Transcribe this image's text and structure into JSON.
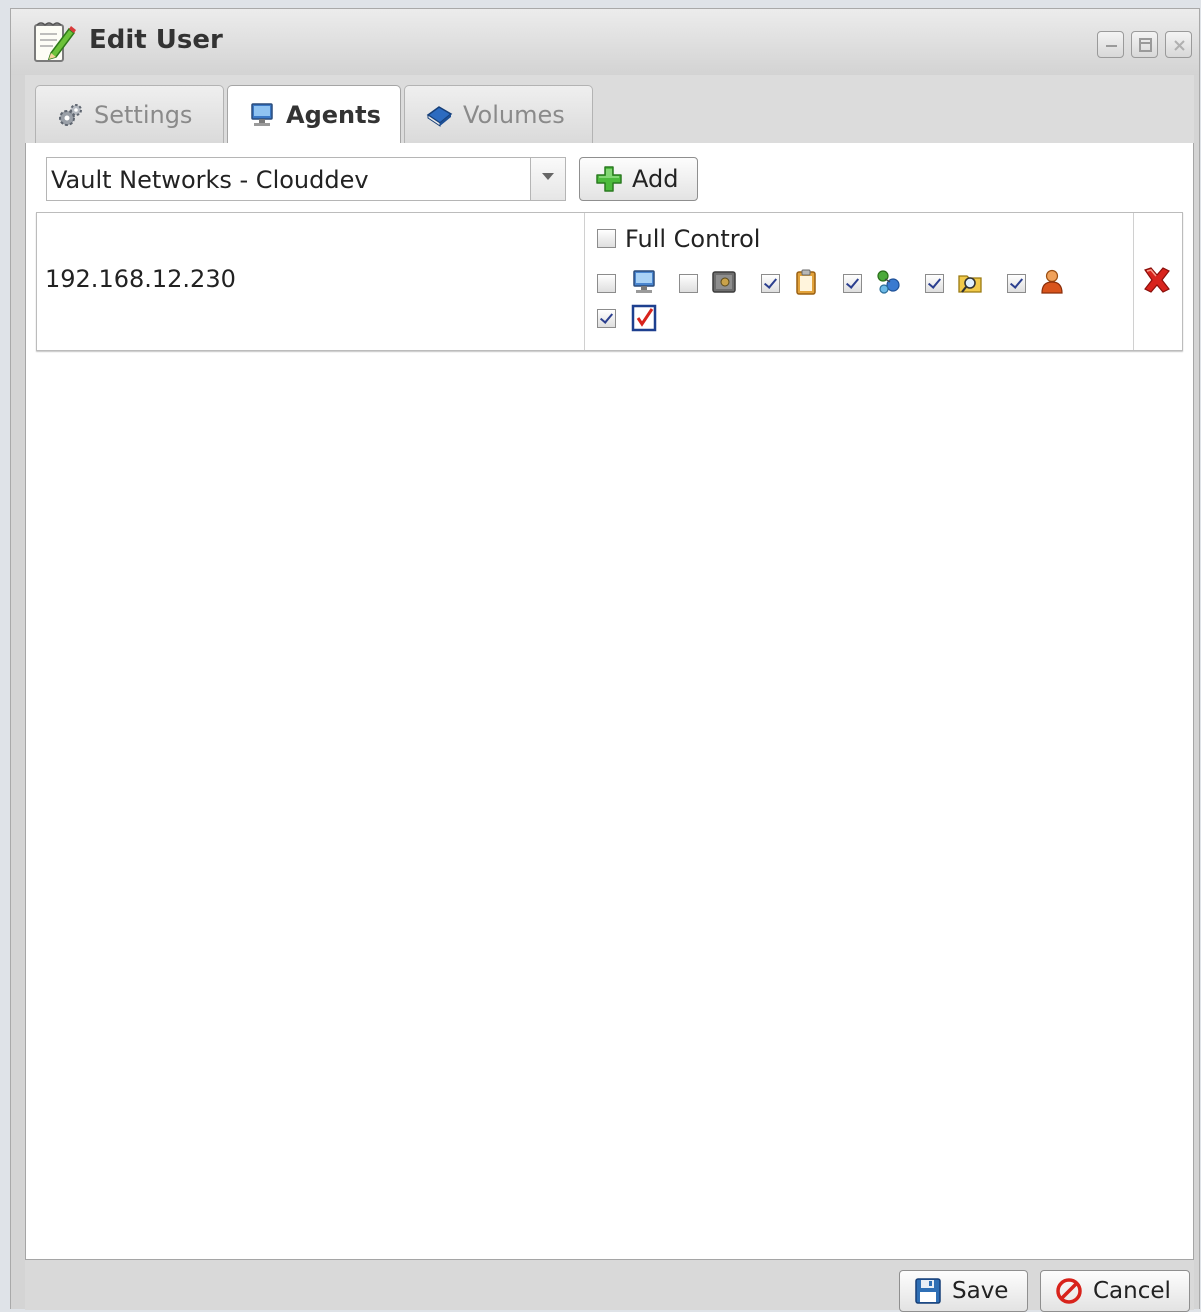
{
  "window": {
    "title": "Edit User",
    "title_icon": "edit-notepad-icon",
    "controls": [
      "minimize-icon",
      "maximize-icon",
      "close-icon"
    ]
  },
  "tabs": [
    {
      "label": "Settings",
      "icon": "gears-icon",
      "active": false
    },
    {
      "label": "Agents",
      "icon": "computer-icon",
      "active": true
    },
    {
      "label": "Volumes",
      "icon": "book-icon",
      "active": false
    }
  ],
  "agent_selector": {
    "selected": "Vault Networks - Clouddev",
    "add_label": "Add"
  },
  "agents": [
    {
      "ip": "192.168.12.230",
      "full_control_label": "Full Control",
      "full_control": false,
      "permissions": [
        {
          "icon": "computer-icon",
          "checked": false
        },
        {
          "icon": "safe-icon",
          "checked": false
        },
        {
          "icon": "clipboard-icon",
          "checked": true
        },
        {
          "icon": "network-icon",
          "checked": true
        },
        {
          "icon": "folder-search-icon",
          "checked": true
        },
        {
          "icon": "user-icon",
          "checked": true
        },
        {
          "icon": "checklist-icon",
          "checked": true
        }
      ]
    }
  ],
  "footer": {
    "save_label": "Save",
    "cancel_label": "Cancel"
  },
  "colors": {
    "accent_blue": "#2f6fb5",
    "delete_red": "#d8231c",
    "add_green": "#39a83a"
  }
}
